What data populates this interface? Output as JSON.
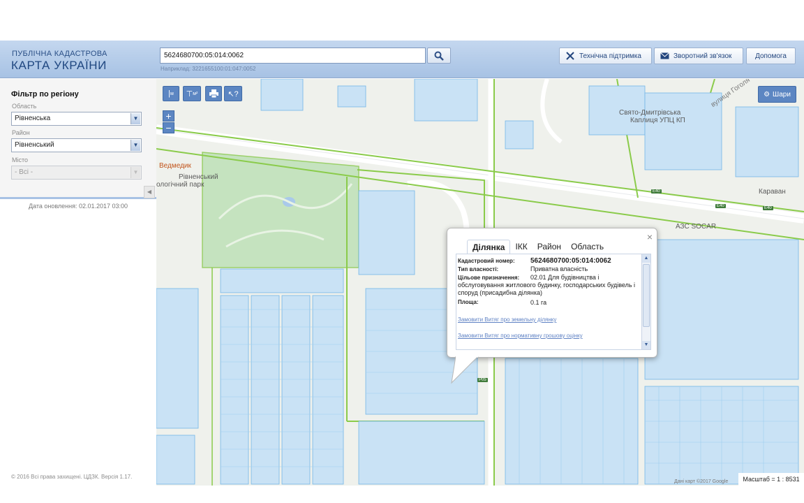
{
  "header": {
    "logo_line1": "ПУБЛІЧНА КАДАСТРОВА",
    "logo_line2": "КАРТА УКРАЇНИ",
    "search_value": "5624680700:05:014:0062",
    "search_hint": "Наприклад: 3221655100:01:047:0052",
    "support_label": "Технічна підтримка",
    "feedback_label": "Зворотний зв'язок",
    "help_label": "Допомога"
  },
  "sidebar": {
    "filter_title": "Фільтр по регіону",
    "region_label": "Область",
    "region_value": "Рівненська",
    "district_label": "Район",
    "district_value": "Рівненський",
    "city_label": "Місто",
    "city_value": "- Всі -",
    "updated": "Дата оновлення: 02.01.2017 03:00",
    "copyright": "© 2016 Всі права захищені. ЦДЗК. Версія 1.17."
  },
  "map": {
    "tool_line_label": "м",
    "tool_area_label": "м²",
    "layers_label": "Шари",
    "poi": [
      "Свято-Дмитрівська",
      "Каплиця УПЦ КП",
      "Ведмедик",
      "Рівненський",
      "ологічний парк",
      "АЗС SOCAR",
      "Караван",
      "вулиця Гоголя"
    ],
    "road_signs": [
      "E40",
      "E40",
      "E40",
      "P05"
    ],
    "scale": "Масштаб = 1 : 8531",
    "attribution": "Дані карт ©2017 Google"
  },
  "popup": {
    "tabs": [
      "Ділянка",
      "ІКК",
      "Район",
      "Область"
    ],
    "active_tab": "Ділянка",
    "fields": [
      {
        "key": "Кадастровий номер:",
        "value": "5624680700:05:014:0062"
      },
      {
        "key": "Тип власності:",
        "value": "Приватна власність"
      },
      {
        "key": "Цільове призначення:",
        "value": "02.01 Для будівництва і обслуговування житлового будинку, господарських будівель і споруд (присадибна ділянка)"
      },
      {
        "key": "Площа:",
        "value": "0.1 га"
      }
    ],
    "link_order_extract": "Замовити Витяг про земельну ділянку",
    "link_order_valuation": "Замовити Витяг про нормативну грошову оцінку"
  },
  "colors": {
    "header_bg": "#b3cbe9",
    "tool_blue": "#5c86c2",
    "parcel_fill": "#c9e2f5",
    "parcel_stroke": "#74b6e6",
    "boundary_green": "#8acb4a",
    "park_green": "#c5e3bf"
  }
}
